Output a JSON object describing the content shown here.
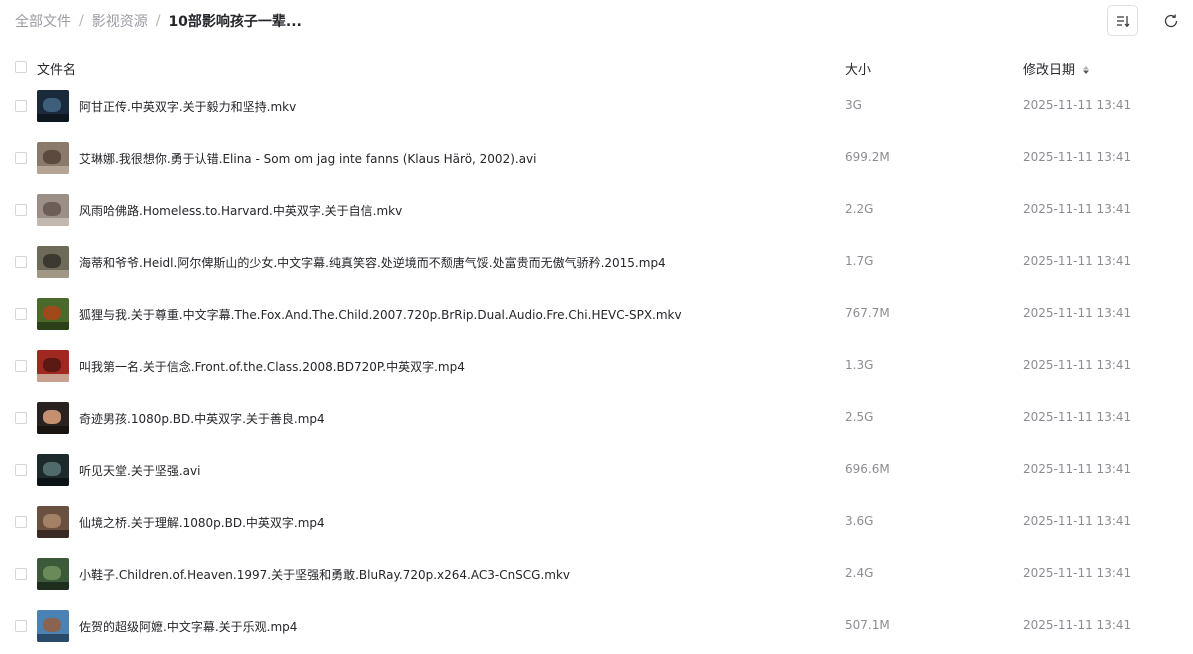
{
  "breadcrumb": {
    "root": "全部文件",
    "parent": "影视资源",
    "current": "10部影响孩子一辈...",
    "separator": "/"
  },
  "toolbar": {
    "sort_icon": "sort-icon",
    "refresh_icon": "refresh-icon"
  },
  "table": {
    "columns": {
      "name": "文件名",
      "size": "大小",
      "modified": "修改日期"
    },
    "sort_indicator_icon": "sort-arrows-icon",
    "rows": [
      {
        "name": "阿甘正传.中英双字.关于毅力和坚持.mkv",
        "size": "3G",
        "modified": "2025-11-11 13:41",
        "thumb": [
          "#1b2a3a",
          "#3d5f7c",
          "#0e1620"
        ]
      },
      {
        "name": "艾琳娜.我很想你.勇于认错.Elina - Som om jag inte fanns (Klaus Härö, 2002).avi",
        "size": "699.2M",
        "modified": "2025-11-11 13:41",
        "thumb": [
          "#8a7a6c",
          "#5c4a3e",
          "#b4a494"
        ]
      },
      {
        "name": "风雨哈佛路.Homeless.to.Harvard.中英双字.关于自信.mkv",
        "size": "2.2G",
        "modified": "2025-11-11 13:41",
        "thumb": [
          "#9c8f88",
          "#6e5e58",
          "#c2b8b0"
        ]
      },
      {
        "name": "海蒂和爷爷.Heidl.阿尔俾斯山的少女.中文字幕.纯真笑容.处逆境而不颓唐气馁.处富贵而无傲气骄矜.2015.mp4",
        "size": "1.7G",
        "modified": "2025-11-11 13:41",
        "thumb": [
          "#6e6a5a",
          "#3c3a30",
          "#a09884"
        ]
      },
      {
        "name": "狐狸与我.关于尊重.中文字幕.The.Fox.And.The.Child.2007.720p.BrRip.Dual.Audio.Fre.Chi.HEVC-SPX.mkv",
        "size": "767.7M",
        "modified": "2025-11-11 13:41",
        "thumb": [
          "#4a6a2c",
          "#a04a1c",
          "#2c4018"
        ]
      },
      {
        "name": "叫我第一名.关于信念.Front.of.the.Class.2008.BD720P.中英双字.mp4",
        "size": "1.3G",
        "modified": "2025-11-11 13:41",
        "thumb": [
          "#a02820",
          "#5c1812",
          "#c8a090"
        ]
      },
      {
        "name": "奇迹男孩.1080p.BD.中英双字.关于善良.mp4",
        "size": "2.5G",
        "modified": "2025-11-11 13:41",
        "thumb": [
          "#2a2220",
          "#c49070",
          "#1a1410"
        ]
      },
      {
        "name": "听见天堂.关于坚强.avi",
        "size": "696.6M",
        "modified": "2025-11-11 13:41",
        "thumb": [
          "#1c2a2c",
          "#506a6a",
          "#0c1416"
        ]
      },
      {
        "name": "仙境之桥.关于理解.1080p.BD.中英双字.mp4",
        "size": "3.6G",
        "modified": "2025-11-11 13:41",
        "thumb": [
          "#6a5040",
          "#a48064",
          "#3a2c22"
        ]
      },
      {
        "name": "小鞋子.Children.of.Heaven.1997.关于坚强和勇敢.BluRay.720p.x264.AC3-CnSCG.mkv",
        "size": "2.4G",
        "modified": "2025-11-11 13:41",
        "thumb": [
          "#3a5a3a",
          "#6a8a5a",
          "#1e2e1e"
        ]
      },
      {
        "name": "佐贺的超级阿嬷.中文字幕.关于乐观.mp4",
        "size": "507.1M",
        "modified": "2025-11-11 13:41",
        "thumb": [
          "#4a82b4",
          "#8a6450",
          "#2a4a6a"
        ]
      }
    ]
  },
  "colors": {
    "text_primary": "#25262b",
    "text_secondary": "#8c8d94",
    "breadcrumb_muted": "#9a9ba3",
    "border": "#dfe0e4"
  }
}
